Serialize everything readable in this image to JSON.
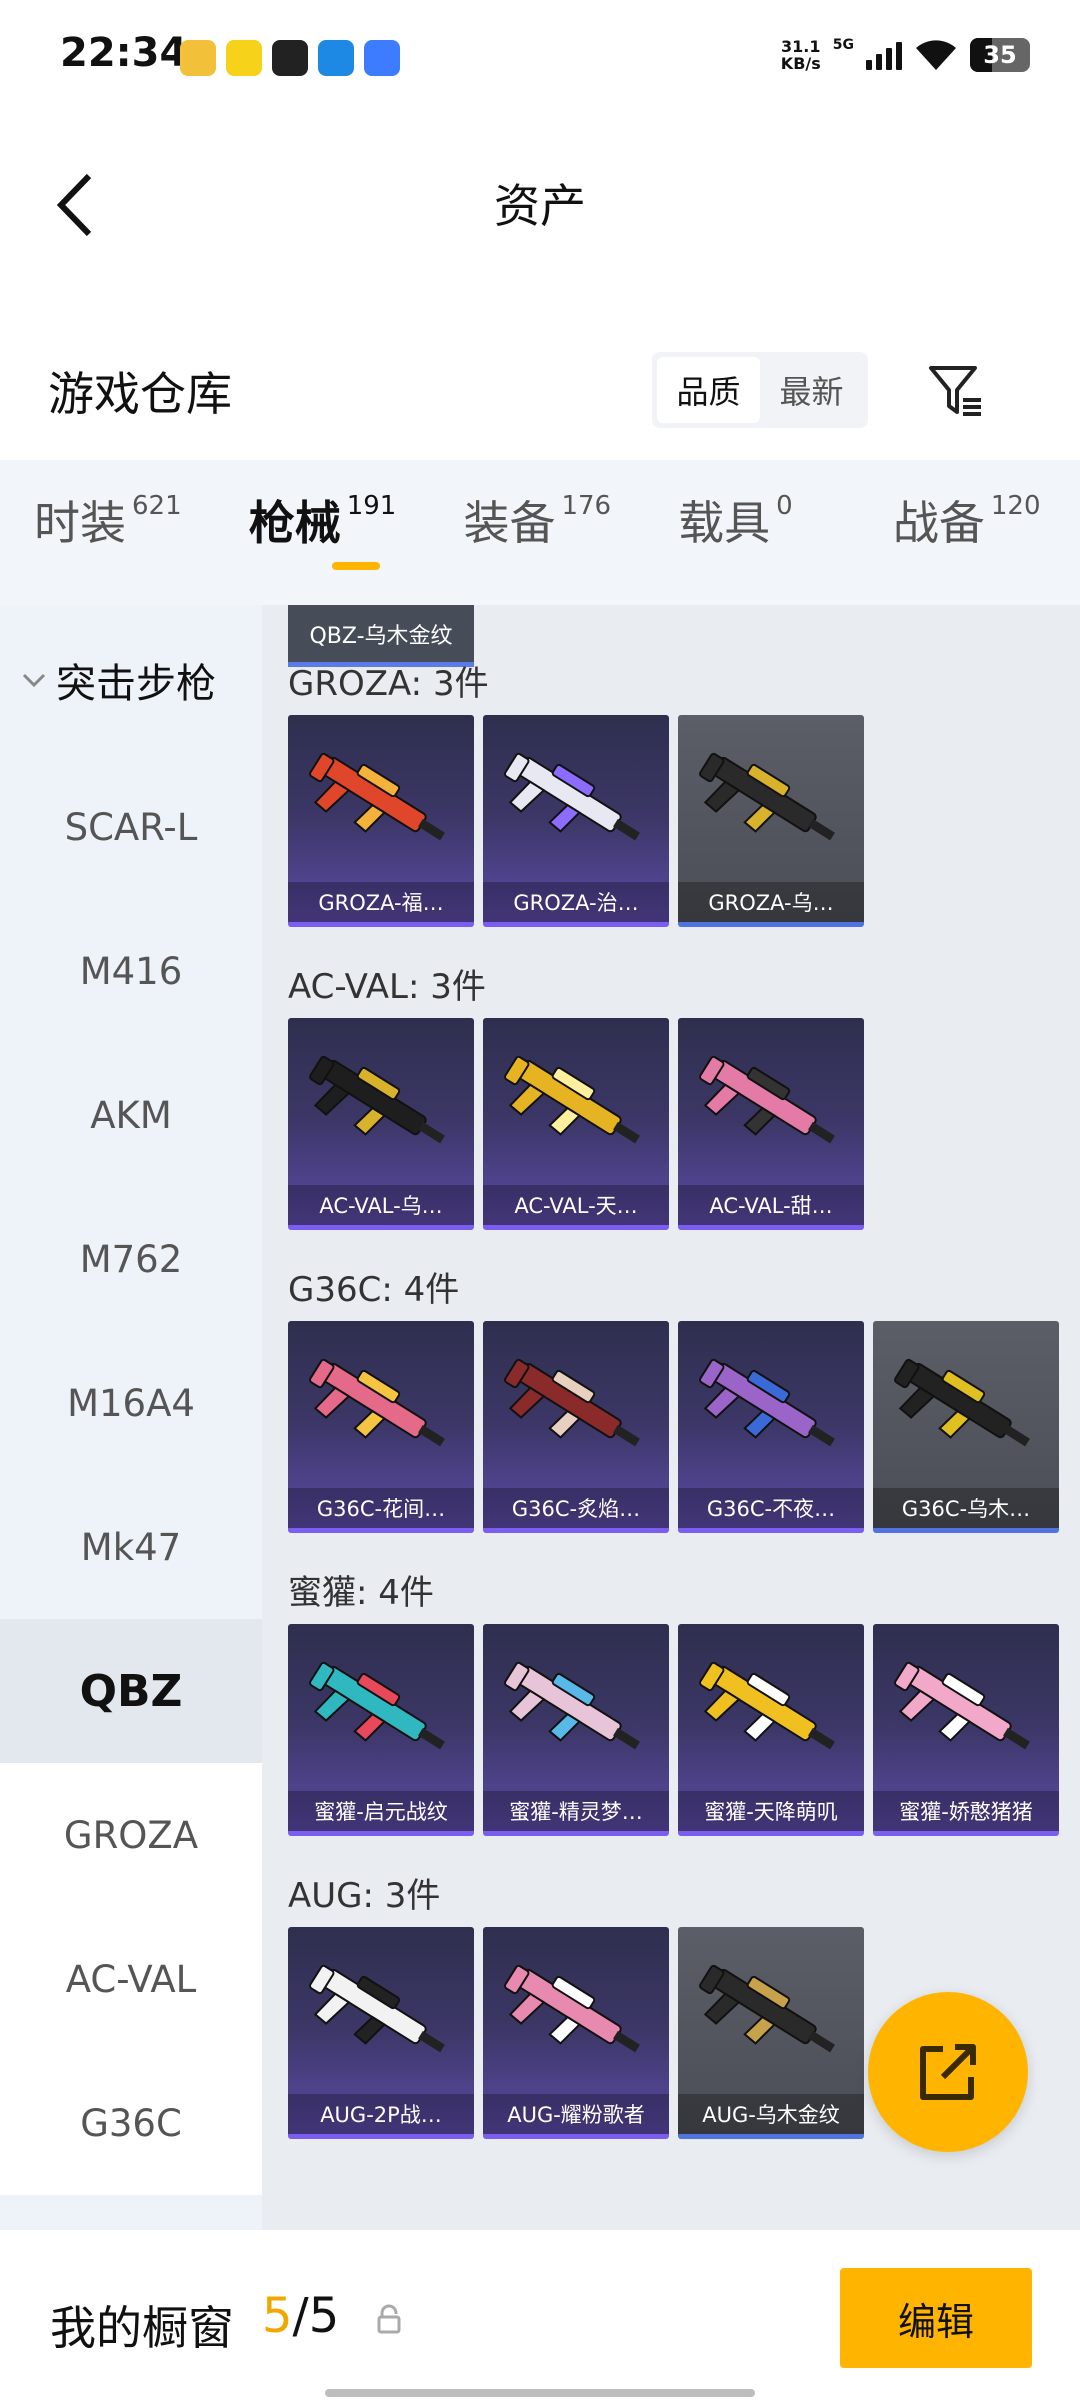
{
  "status_bar": {
    "time": "22:34",
    "net_speed_value": "31.1",
    "net_speed_unit": "KB/s",
    "network": "5G",
    "battery": "35",
    "apps": [
      {
        "name": "app-1",
        "color": "#f3c03a"
      },
      {
        "name": "app-2",
        "color": "#f6d21b"
      },
      {
        "name": "app-3",
        "color": "#222222"
      },
      {
        "name": "app-4",
        "color": "#1e88e5"
      },
      {
        "name": "vivo",
        "color": "#3d7bff"
      }
    ]
  },
  "header": {
    "title": "资产"
  },
  "warehouse": {
    "title": "游戏仓库",
    "sort_options": [
      "品质",
      "最新"
    ],
    "active_sort": "品质"
  },
  "tabs": [
    {
      "label": "时装",
      "count": "621"
    },
    {
      "label": "枪械",
      "count": "191",
      "active": true
    },
    {
      "label": "装备",
      "count": "176"
    },
    {
      "label": "载具",
      "count": "0"
    },
    {
      "label": "战备",
      "count": "120"
    }
  ],
  "sidebar": {
    "group": "突击步枪",
    "items": [
      "SCAR-L",
      "M416",
      "AKM",
      "M762",
      "M16A4",
      "Mk47",
      "QBZ",
      "GROZA",
      "AC-VAL",
      "G36C"
    ],
    "active": "QBZ"
  },
  "content": {
    "partial_card": "QBZ-乌木金纹",
    "sections": [
      {
        "title": "GROZA: 3件",
        "cards": [
          {
            "label": "GROZA-福…",
            "style": "purple",
            "gun_color": "#e0472a",
            "accent": "#f4b23a"
          },
          {
            "label": "GROZA-治…",
            "style": "purple",
            "gun_color": "#e8e8f2",
            "accent": "#8c6cff"
          },
          {
            "label": "GROZA-乌…",
            "style": "grey",
            "gun_color": "#2a2a2a",
            "accent": "#d8b22a"
          }
        ]
      },
      {
        "title": "AC-VAL: 3件",
        "cards": [
          {
            "label": "AC-VAL-乌…",
            "style": "purple",
            "gun_color": "#1e1e1e",
            "accent": "#d8b22a"
          },
          {
            "label": "AC-VAL-天…",
            "style": "purple",
            "gun_color": "#e6b422",
            "accent": "#fff0a0"
          },
          {
            "label": "AC-VAL-甜…",
            "style": "purple",
            "gun_color": "#e47aa6",
            "accent": "#333333"
          }
        ]
      },
      {
        "title": "G36C: 4件",
        "cards": [
          {
            "label": "G36C-花间…",
            "style": "purple",
            "gun_color": "#e56a8a",
            "accent": "#f5c542"
          },
          {
            "label": "G36C-炙焰…",
            "style": "purple",
            "gun_color": "#8a2a2a",
            "accent": "#e8d0c0"
          },
          {
            "label": "G36C-不夜…",
            "style": "purple",
            "gun_color": "#9a64c8",
            "accent": "#3a6ad8"
          },
          {
            "label": "G36C-乌木…",
            "style": "grey",
            "gun_color": "#222222",
            "accent": "#e0c020"
          }
        ]
      },
      {
        "title": "蜜獾: 4件",
        "cards": [
          {
            "label": "蜜獾-启元战纹",
            "style": "purple",
            "gun_color": "#2fb8c0",
            "accent": "#e8485a"
          },
          {
            "label": "蜜獾-精灵梦…",
            "style": "purple",
            "gun_color": "#e8c4d8",
            "accent": "#58b8e8"
          },
          {
            "label": "蜜獾-天降萌叽",
            "style": "purple",
            "gun_color": "#f0c020",
            "accent": "#ffffff"
          },
          {
            "label": "蜜獾-娇憨猪猪",
            "style": "purple",
            "gun_color": "#f2a8c8",
            "accent": "#ffffff"
          }
        ]
      },
      {
        "title": "AUG: 3件",
        "cards": [
          {
            "label": "AUG-2P战…",
            "style": "purple",
            "gun_color": "#f2f2f2",
            "accent": "#222222"
          },
          {
            "label": "AUG-耀粉歌者",
            "style": "purple",
            "gun_color": "#e88ab0",
            "accent": "#ffffff"
          },
          {
            "label": "AUG-乌木金纹",
            "style": "grey",
            "gun_color": "#2a2a2a",
            "accent": "#c8a24a"
          }
        ]
      }
    ]
  },
  "bottom_bar": {
    "title": "我的橱窗",
    "current": "5",
    "separator": "/",
    "total": "5",
    "edit_label": "编辑"
  },
  "colors": {
    "accent": "#ffb400",
    "sidebar_bg": "#eef3f9",
    "content_bg": "#e9edf2",
    "card_border_purple": "#7b5df0",
    "card_border_grey": "#4f73e0"
  }
}
